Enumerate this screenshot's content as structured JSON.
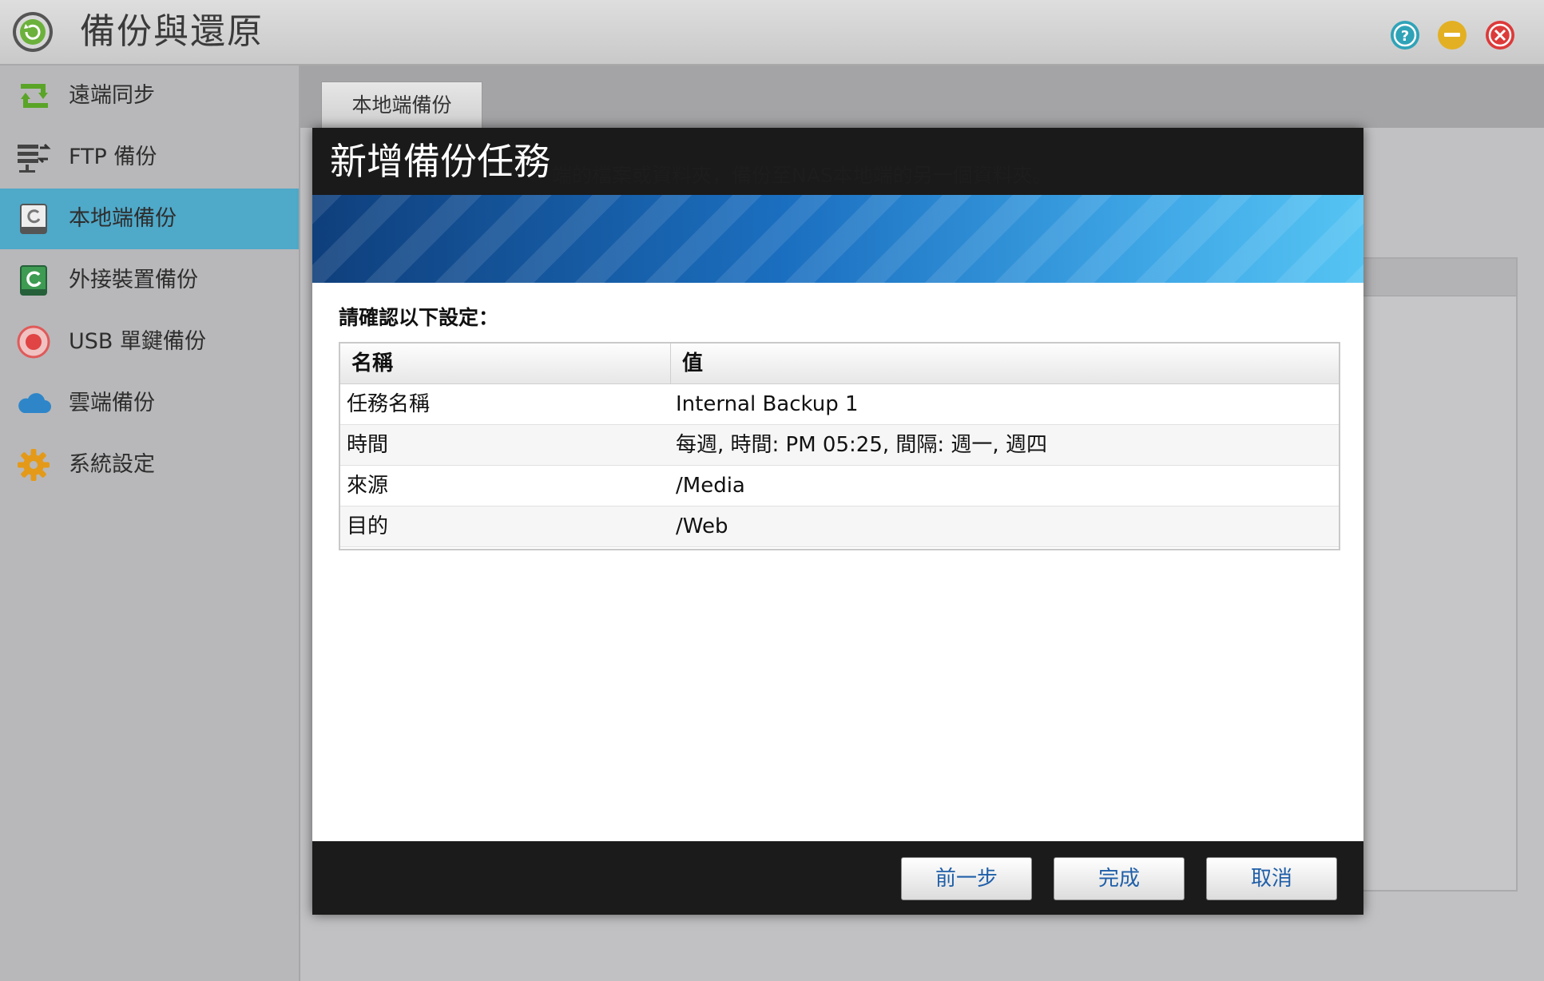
{
  "window": {
    "title": "備份與還原",
    "help_icon": "help-icon",
    "minimize_icon": "minimize-icon",
    "close_icon": "close-icon"
  },
  "sidebar": {
    "items": [
      {
        "label": "遠端同步",
        "icon": "sync-arrows-icon",
        "active": false
      },
      {
        "label": "FTP 備份",
        "icon": "ftp-transfer-icon",
        "active": false
      },
      {
        "label": "本地端備份",
        "icon": "local-disk-backup-icon",
        "active": true
      },
      {
        "label": "外接裝置備份",
        "icon": "external-device-icon",
        "active": false
      },
      {
        "label": "USB 單鍵備份",
        "icon": "usb-one-touch-icon",
        "active": false
      },
      {
        "label": "雲端備份",
        "icon": "cloud-icon",
        "active": false
      },
      {
        "label": "系統設定",
        "icon": "gear-icon",
        "active": false
      }
    ]
  },
  "main": {
    "tabs": [
      {
        "label": "本地端備份"
      }
    ],
    "background_text": "端的檔案或資料夾，備份至NAS本地端的另一個資料夾。"
  },
  "dialog": {
    "title": "新增備份任務",
    "confirm_label": "請確認以下設定：",
    "table": {
      "headers": [
        "名稱",
        "值"
      ],
      "rows": [
        [
          "任務名稱",
          "Internal Backup 1"
        ],
        [
          "時間",
          "每週, 時間: PM 05:25, 間隔: 週一, 週四"
        ],
        [
          "來源",
          "/Media"
        ],
        [
          "目的",
          "/Web"
        ]
      ]
    },
    "buttons": {
      "prev": "前一步",
      "finish": "完成",
      "cancel": "取消"
    }
  },
  "colors": {
    "sidebar_active": "#4fa9c9",
    "dialog_header": "#1a1a1a",
    "button_text": "#1f5fa8",
    "banner_blue": "#1b6fc0"
  }
}
